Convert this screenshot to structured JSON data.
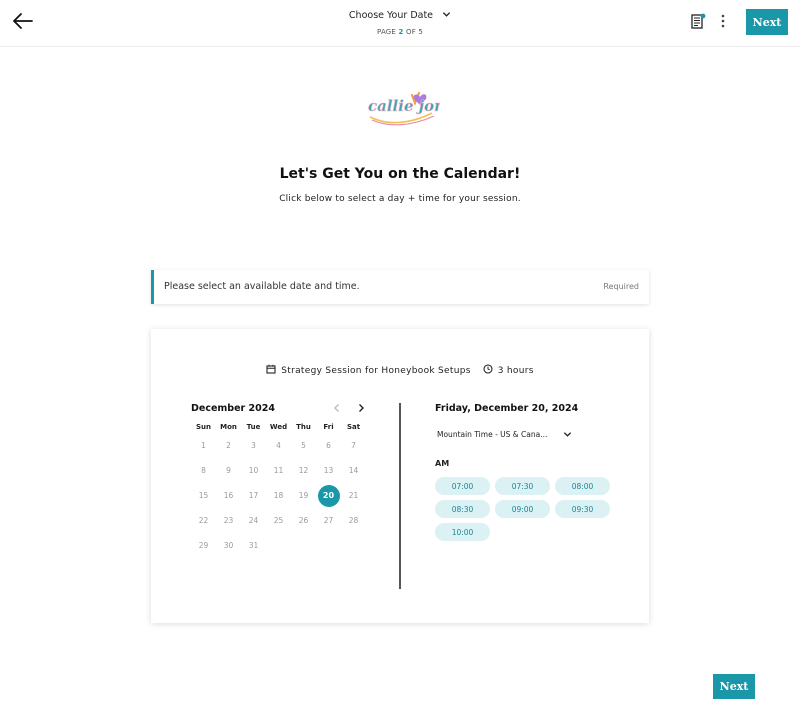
{
  "header": {
    "step_title": "Choose Your Date",
    "page_prefix": "PAGE",
    "page_current": "2",
    "page_of": "OF 5",
    "next_label": "Next"
  },
  "logo": {
    "text": "callie jones"
  },
  "intro": {
    "title": "Let's Get You on the Calendar!",
    "subtitle": "Click below to select a day + time for your session."
  },
  "notice": {
    "message": "Please select an available date and time.",
    "required": "Required"
  },
  "scheduler": {
    "session_name": "Strategy Session for Honeybook Setups",
    "duration": "3 hours",
    "calendar": {
      "month": "December 2024",
      "weekdays": [
        "Sun",
        "Mon",
        "Tue",
        "Wed",
        "Thu",
        "Fri",
        "Sat"
      ],
      "weeks": [
        [
          "1",
          "2",
          "3",
          "4",
          "5",
          "6",
          "7"
        ],
        [
          "8",
          "9",
          "10",
          "11",
          "12",
          "13",
          "14"
        ],
        [
          "15",
          "16",
          "17",
          "18",
          "19",
          "20",
          "21"
        ],
        [
          "22",
          "23",
          "24",
          "25",
          "26",
          "27",
          "28"
        ],
        [
          "29",
          "30",
          "31",
          "",
          "",
          "",
          ""
        ]
      ],
      "selected": "20"
    },
    "selected_day": "Friday, December 20, 2024",
    "timezone": "Mountain Time - US & Cana...",
    "period": "AM",
    "slots": [
      "07:00",
      "07:30",
      "08:00",
      "08:30",
      "09:00",
      "09:30",
      "10:00"
    ]
  },
  "footer": {
    "next_label": "Next"
  },
  "colors": {
    "accent": "#1a97a8",
    "slot_bg": "#dcf1f3"
  },
  "icons": [
    "back-arrow-icon",
    "chevron-down-icon",
    "document-icon",
    "more-vertical-icon",
    "calendar-icon",
    "clock-icon",
    "chevron-left-icon",
    "chevron-right-icon"
  ]
}
